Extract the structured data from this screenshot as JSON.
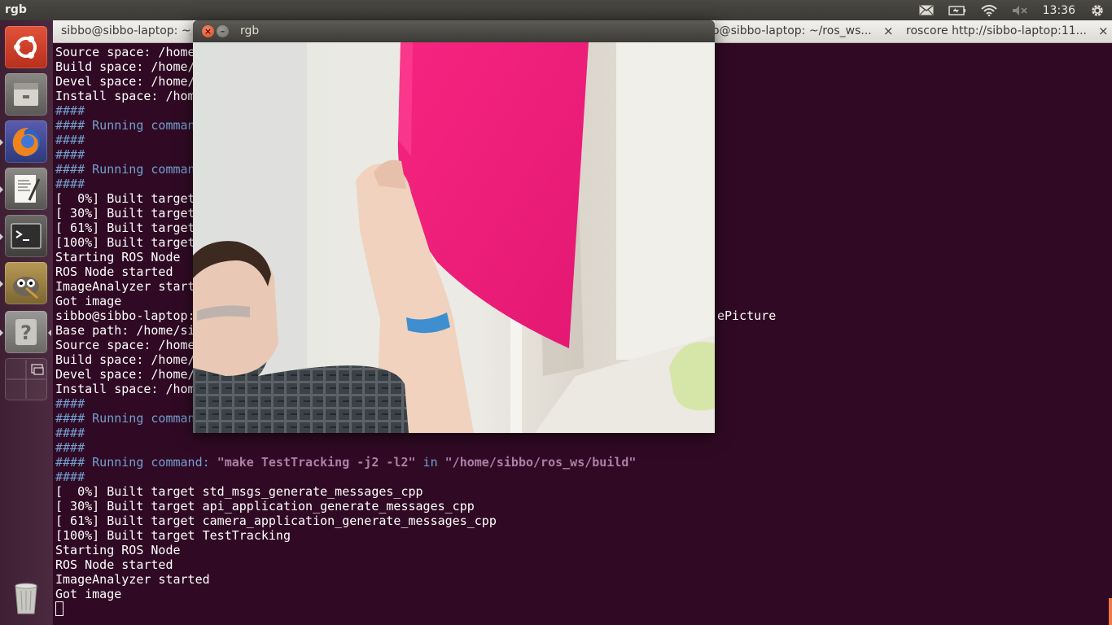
{
  "top_panel": {
    "app_title": "rgb",
    "clock": "13:36",
    "icons": [
      "mail-icon",
      "battery-icon",
      "wifi-icon",
      "volume-muted-icon",
      "system-gear-icon"
    ]
  },
  "launcher": {
    "items": [
      "ubuntu-dash-icon",
      "files-icon",
      "firefox-icon",
      "text-editor-icon",
      "terminal-icon",
      "gimp-icon",
      "help-icon",
      "workspace-switcher-icon",
      "trash-icon"
    ]
  },
  "terminal": {
    "tabs": [
      {
        "label": "sibbo@sibbo-laptop: ~/"
      },
      {
        "label": "o@sibbo-laptop: ~/ros_ws..."
      },
      {
        "label": "roscore http://sibbo-laptop:11..."
      }
    ],
    "tab_close": "×",
    "lines": [
      {
        "a": "Source space: /home"
      },
      {
        "a": "Build space: /home/"
      },
      {
        "a": "Devel space: /home/"
      },
      {
        "a": "Install space: /hom"
      },
      {
        "h": "####"
      },
      {
        "h": "#### Running comman"
      },
      {
        "h": "####"
      },
      {
        "h": "####"
      },
      {
        "h": "#### Running comman"
      },
      {
        "h": "####"
      },
      {
        "a": "[  0%] Built target"
      },
      {
        "a": "[ 30%] Built target"
      },
      {
        "a": "[ 61%] Built target"
      },
      {
        "a": "[100%] Built target"
      },
      {
        "a": "Starting ROS Node"
      },
      {
        "a": "ROS Node started"
      },
      {
        "a": "ImageAnalyzer start"
      },
      {
        "a": "Got image"
      },
      {
        "a": "sibbo@sibbo-laptop:",
        "b": "ePicture"
      },
      {
        "a": "Base path: /home/si"
      },
      {
        "a": "Source space: /home"
      },
      {
        "a": "Build space: /home/"
      },
      {
        "a": "Devel space: /home/"
      },
      {
        "a": "Install space: /hom"
      },
      {
        "h": "####"
      },
      {
        "h": "#### Running comman"
      },
      {
        "h": "####"
      },
      {
        "h": "####"
      },
      {
        "h": "#### Running command: ",
        "s1": "\"make TestTracking -j2 -l2\"",
        "h2": " in ",
        "s2": "\"/home/sibbo/ros_ws/build\""
      },
      {
        "h": "####"
      },
      {
        "a": "[  0%] Built target std_msgs_generate_messages_cpp"
      },
      {
        "a": "[ 30%] Built target api_application_generate_messages_cpp"
      },
      {
        "a": "[ 61%] Built target camera_application_generate_messages_cpp"
      },
      {
        "a": "[100%] Built target TestTracking"
      },
      {
        "a": "Starting ROS Node"
      },
      {
        "a": "ROS Node started"
      },
      {
        "a": "ImageAnalyzer started"
      },
      {
        "a": "Got image"
      }
    ]
  },
  "rgb_window": {
    "title": "rgb",
    "close_glyph": "×",
    "minimize_glyph": "–"
  },
  "colors": {
    "terminal_bg": "#300a24",
    "hash_blue": "#729fcf",
    "string_purple": "#ad7fa8",
    "pink_sheet": "#ee1f7a"
  }
}
